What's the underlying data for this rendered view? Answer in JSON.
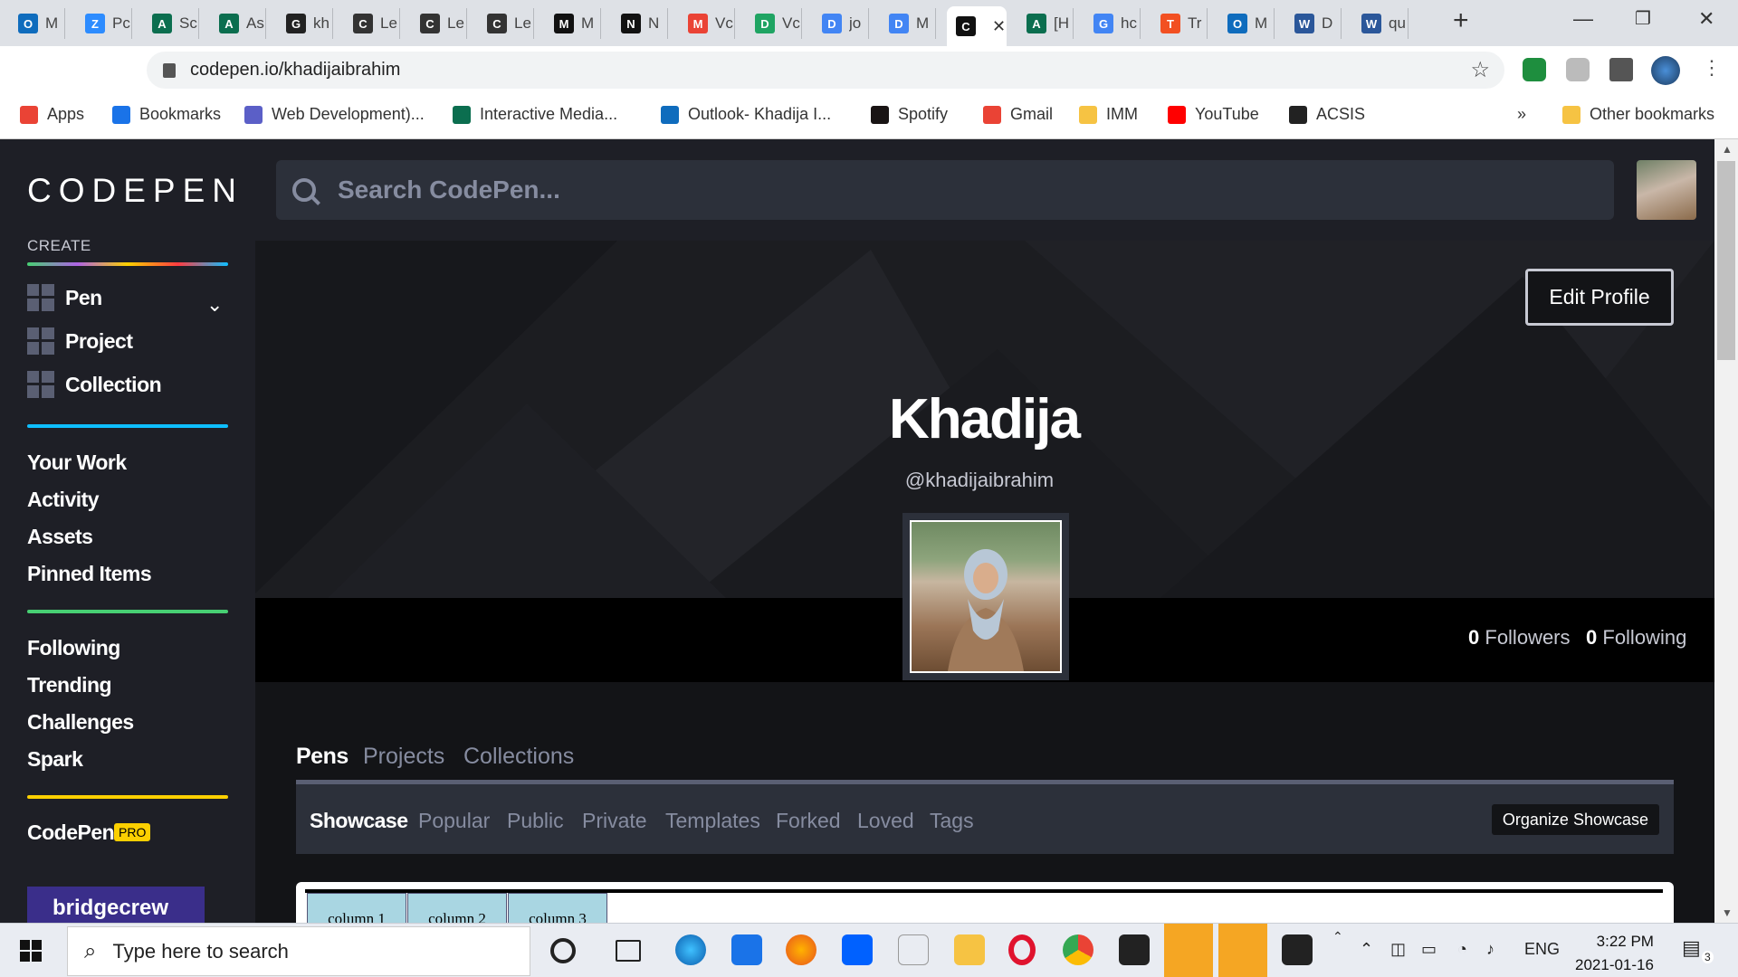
{
  "browser": {
    "tabs": [
      {
        "label": "M",
        "icon_color": "#0f6cbd",
        "icon": "O"
      },
      {
        "label": "Pc",
        "icon_color": "#2d8cff",
        "icon": "Z"
      },
      {
        "label": "Sc",
        "icon_color": "#0b6e4f",
        "icon": "A"
      },
      {
        "label": "As",
        "icon_color": "#0b6e4f",
        "icon": "A"
      },
      {
        "label": "kh",
        "icon_color": "#222",
        "icon": "G"
      },
      {
        "label": "Le",
        "icon_color": "#333",
        "icon": "C"
      },
      {
        "label": "Le",
        "icon_color": "#333",
        "icon": "C"
      },
      {
        "label": "Le",
        "icon_color": "#333",
        "icon": "C"
      },
      {
        "label": "M",
        "icon_color": "#111",
        "icon": "M"
      },
      {
        "label": "N",
        "icon_color": "#111",
        "icon": "N"
      },
      {
        "label": "Vc",
        "icon_color": "#ea4335",
        "icon": "M"
      },
      {
        "label": "Vc",
        "icon_color": "#1fa463",
        "icon": "D"
      },
      {
        "label": "jo",
        "icon_color": "#4285f4",
        "icon": "D"
      },
      {
        "label": "M",
        "icon_color": "#4285f4",
        "icon": "D"
      },
      {
        "label": "",
        "icon_color": "#111",
        "icon": "C"
      },
      {
        "label": "[H",
        "icon_color": "#0b6e4f",
        "icon": "A"
      },
      {
        "label": "hc",
        "icon_color": "#4285f4",
        "icon": "G"
      },
      {
        "label": "Tr",
        "icon_color": "#f25022",
        "icon": "T"
      },
      {
        "label": "M",
        "icon_color": "#0f6cbd",
        "icon": "O"
      },
      {
        "label": "D",
        "icon_color": "#2b579a",
        "icon": "W"
      },
      {
        "label": "qu",
        "icon_color": "#2b579a",
        "icon": "W"
      }
    ],
    "new_tab_glyph": "+",
    "url": "codepen.io/khadijaibrahim",
    "bookmarks": [
      {
        "label": "Apps",
        "color": "#ea4335"
      },
      {
        "label": "Bookmarks",
        "color": "#1a73e8"
      },
      {
        "label": "Web Development)...",
        "color": "#5b5fc7"
      },
      {
        "label": "Interactive Media...",
        "color": "#0b6e4f"
      },
      {
        "label": "Outlook- Khadija I...",
        "color": "#0f6cbd"
      },
      {
        "label": "Spotify",
        "color": "#191414"
      },
      {
        "label": "Gmail",
        "color": "#ea4335"
      },
      {
        "label": "IMM",
        "color": "#f6c343"
      },
      {
        "label": "YouTube",
        "color": "#ff0000"
      },
      {
        "label": "ACSIS",
        "color": "#222"
      }
    ],
    "more_bookmarks": "»",
    "other_bookmarks": "Other bookmarks"
  },
  "sidebar": {
    "logo": "CODEPEN",
    "create_label": "CREATE",
    "create_items": [
      {
        "label": "Pen"
      },
      {
        "label": "Project"
      },
      {
        "label": "Collection"
      }
    ],
    "nav1": [
      "Your Work",
      "Activity",
      "Assets",
      "Pinned Items"
    ],
    "nav2": [
      "Following",
      "Trending",
      "Challenges",
      "Spark"
    ],
    "codepen_label": "CodePen",
    "pro_badge": "PRO",
    "ad_text": "bridgecrew"
  },
  "search": {
    "placeholder": "Search CodePen..."
  },
  "profile": {
    "edit_button": "Edit Profile",
    "name": "Khadija",
    "handle": "@khadijaibrahim",
    "followers_count": "0",
    "followers_label": "Followers",
    "following_count": "0",
    "following_label": "Following"
  },
  "content_tabs": [
    "Pens",
    "Projects",
    "Collections"
  ],
  "sub_tabs": [
    "Showcase",
    "Popular",
    "Public",
    "Private",
    "Templates",
    "Forked",
    "Loved",
    "Tags"
  ],
  "organize_button": "Organize Showcase",
  "preview_columns": [
    "column 1",
    "column 2",
    "column 3"
  ],
  "taskbar": {
    "search_placeholder": "Type here to search",
    "language": "ENG",
    "time": "3:22 PM",
    "date": "2021-01-16",
    "notification_count": "3"
  },
  "colors": {
    "accent_green": "#47cf73",
    "accent_blue": "#0ebeff",
    "accent_yellow": "#fcd000"
  }
}
